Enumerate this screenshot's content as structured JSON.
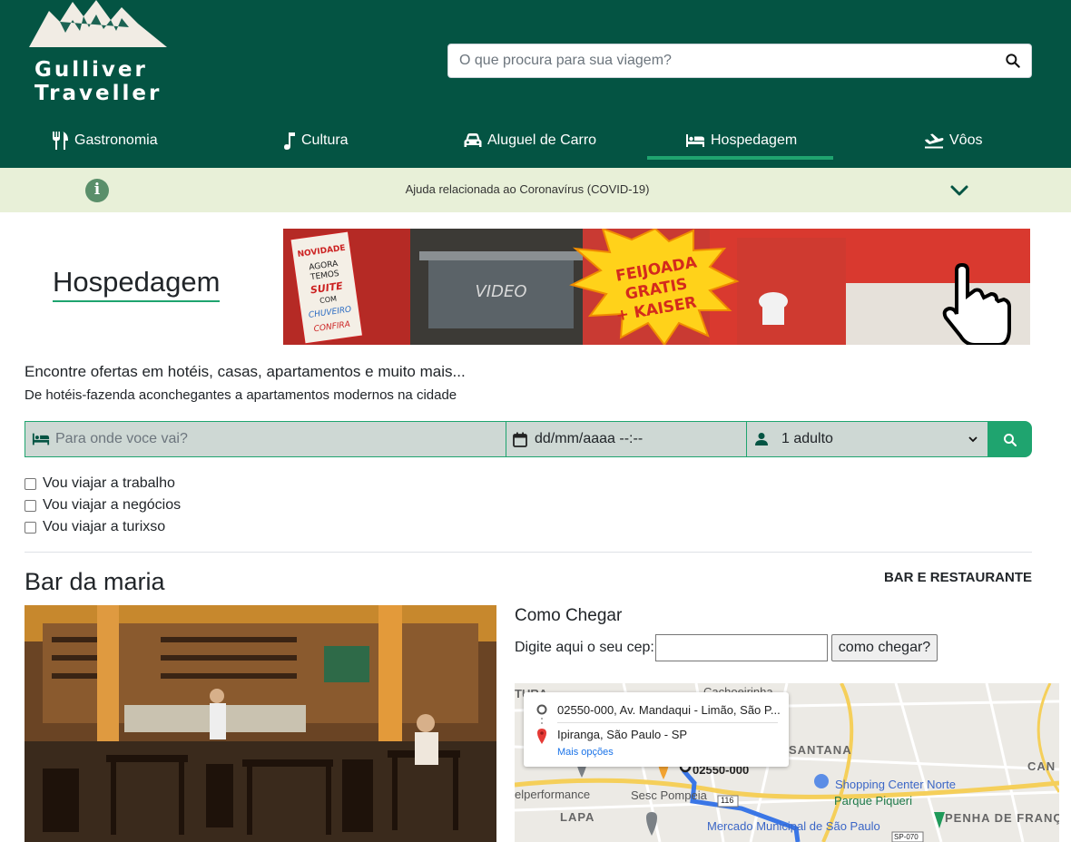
{
  "brand": {
    "line1": "Gulliver",
    "line2": "Traveller"
  },
  "search": {
    "placeholder": "O que procura para sua viagem?"
  },
  "nav": [
    {
      "label": "Gastronomia",
      "icon": "utensils-icon"
    },
    {
      "label": "Cultura",
      "icon": "music-note-icon"
    },
    {
      "label": "Aluguel de Carro",
      "icon": "car-icon"
    },
    {
      "label": "Hospedagem",
      "icon": "bed-icon",
      "active": true
    },
    {
      "label": "Vôos",
      "icon": "plane-icon"
    }
  ],
  "covid": {
    "text": "Ajuda relacionada ao Coronavírus (COVID-19)",
    "icon": "info-icon"
  },
  "section": {
    "title": "Hospedagem"
  },
  "banner": {
    "promo": [
      "FEIJOADA",
      "GRATIS",
      "+ KAISER"
    ],
    "sign": [
      "NOVIDADE",
      "AGORA",
      "TEMOS",
      "SUITE",
      "COM",
      "CHUVEIRO",
      "CONFIRA"
    ],
    "video": "VIDEO"
  },
  "intro": {
    "headline": "Encontre ofertas em hotéis, casas, apartamentos e muito mais...",
    "sub": "De hotéis-fazenda aconchegantes a apartamentos modernos na cidade"
  },
  "booking": {
    "destination_placeholder": "Para onde voce vai?",
    "date_value": "dd/mm/aaaa --:--",
    "guests_value": "1 adulto"
  },
  "trip_types": [
    "Vou viajar a trabalho",
    "Vou viajar a negócios",
    "Vou viajar a turixso"
  ],
  "place": {
    "name": "Bar da maria",
    "category": "BAR E RESTAURANTE"
  },
  "route": {
    "title": "Como Chegar",
    "cep_label": "Digite aqui o seu cep:",
    "cep_value": "",
    "button": "como chegar?"
  },
  "map": {
    "origin": "02550-000, Av. Mandaqui - Limão, São P...",
    "destination": "Ipiranga, São Paulo - SP",
    "more": "Mais opções",
    "labels": [
      "Cachoeirinha",
      "SANTANA",
      "Shopping Center Norte",
      "Parque Piqueri",
      "PENHA DE FRANÇA",
      "CAN",
      "Sesc Pompeia",
      "LAPA",
      "Mercado Municipal de São Paulo",
      "02550-000",
      "116",
      "SP-070",
      "elperformance",
      "TURA"
    ]
  },
  "colors": {
    "header_bg": "#045443",
    "accent": "#1fa46f",
    "covid_bg": "#e8f0d8",
    "field_bg": "#ced8d4"
  }
}
